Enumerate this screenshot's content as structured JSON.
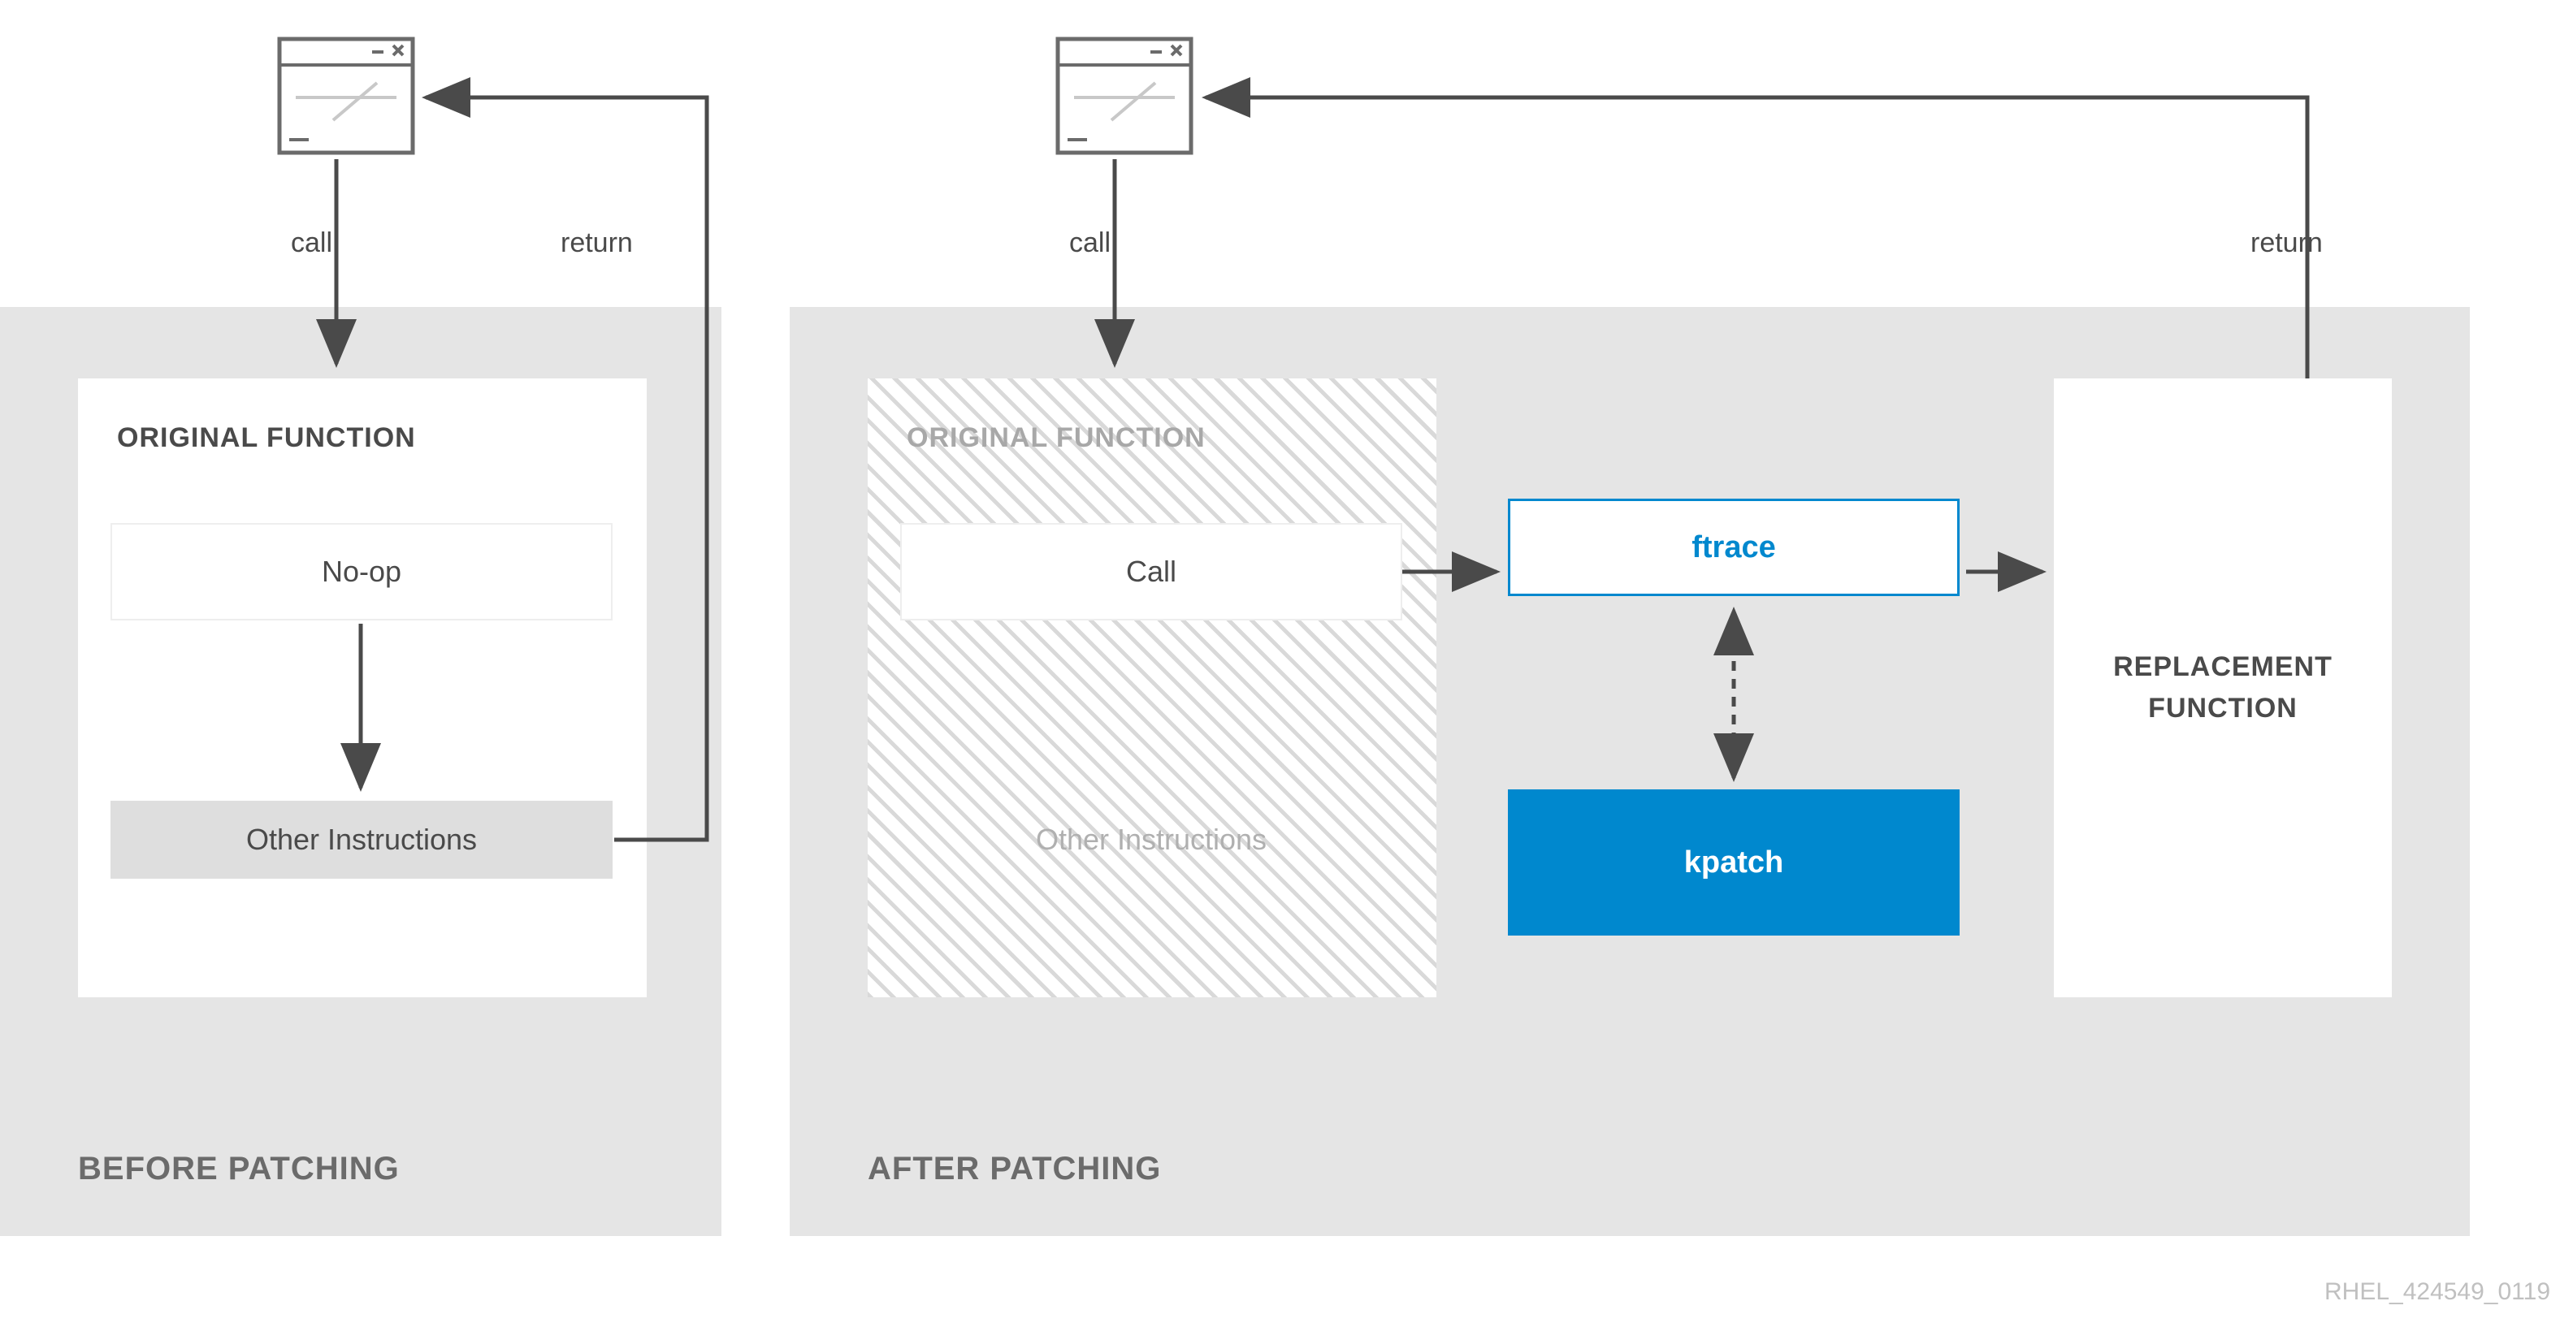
{
  "diagram": {
    "footer_id": "RHEL_424549_0119",
    "before": {
      "state_label": "BEFORE PATCHING",
      "original_title": "ORIGINAL FUNCTION",
      "noop": "No-op",
      "other_instructions": "Other Instructions",
      "call_label": "call",
      "return_label": "return"
    },
    "after": {
      "state_label": "AFTER PATCHING",
      "original_title": "ORIGINAL FUNCTION",
      "call_box": "Call",
      "other_instructions": "Other Instructions",
      "ftrace": "ftrace",
      "kpatch": "kpatch",
      "replacement": "REPLACEMENT FUNCTION",
      "call_label": "call",
      "return_label": "return"
    },
    "colors": {
      "panel_bg": "#e5e5e5",
      "accent_blue": "#0088ce",
      "text_gray": "#4a4a4a",
      "muted_gray": "#a8a8a8"
    }
  }
}
